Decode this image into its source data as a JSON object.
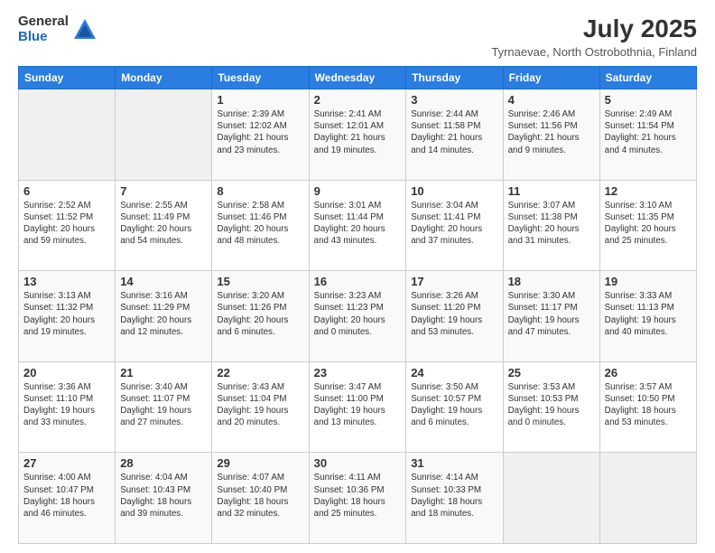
{
  "header": {
    "logo_general": "General",
    "logo_blue": "Blue",
    "title": "July 2025",
    "subtitle": "Tyrnaevae, North Ostrobothnia, Finland"
  },
  "days_of_week": [
    "Sunday",
    "Monday",
    "Tuesday",
    "Wednesday",
    "Thursday",
    "Friday",
    "Saturday"
  ],
  "weeks": [
    [
      {
        "day": "",
        "info": ""
      },
      {
        "day": "",
        "info": ""
      },
      {
        "day": "1",
        "info": "Sunrise: 2:39 AM\nSunset: 12:02 AM\nDaylight: 21 hours and 23 minutes."
      },
      {
        "day": "2",
        "info": "Sunrise: 2:41 AM\nSunset: 12:01 AM\nDaylight: 21 hours and 19 minutes."
      },
      {
        "day": "3",
        "info": "Sunrise: 2:44 AM\nSunset: 11:58 PM\nDaylight: 21 hours and 14 minutes."
      },
      {
        "day": "4",
        "info": "Sunrise: 2:46 AM\nSunset: 11:56 PM\nDaylight: 21 hours and 9 minutes."
      },
      {
        "day": "5",
        "info": "Sunrise: 2:49 AM\nSunset: 11:54 PM\nDaylight: 21 hours and 4 minutes."
      }
    ],
    [
      {
        "day": "6",
        "info": "Sunrise: 2:52 AM\nSunset: 11:52 PM\nDaylight: 20 hours and 59 minutes."
      },
      {
        "day": "7",
        "info": "Sunrise: 2:55 AM\nSunset: 11:49 PM\nDaylight: 20 hours and 54 minutes."
      },
      {
        "day": "8",
        "info": "Sunrise: 2:58 AM\nSunset: 11:46 PM\nDaylight: 20 hours and 48 minutes."
      },
      {
        "day": "9",
        "info": "Sunrise: 3:01 AM\nSunset: 11:44 PM\nDaylight: 20 hours and 43 minutes."
      },
      {
        "day": "10",
        "info": "Sunrise: 3:04 AM\nSunset: 11:41 PM\nDaylight: 20 hours and 37 minutes."
      },
      {
        "day": "11",
        "info": "Sunrise: 3:07 AM\nSunset: 11:38 PM\nDaylight: 20 hours and 31 minutes."
      },
      {
        "day": "12",
        "info": "Sunrise: 3:10 AM\nSunset: 11:35 PM\nDaylight: 20 hours and 25 minutes."
      }
    ],
    [
      {
        "day": "13",
        "info": "Sunrise: 3:13 AM\nSunset: 11:32 PM\nDaylight: 20 hours and 19 minutes."
      },
      {
        "day": "14",
        "info": "Sunrise: 3:16 AM\nSunset: 11:29 PM\nDaylight: 20 hours and 12 minutes."
      },
      {
        "day": "15",
        "info": "Sunrise: 3:20 AM\nSunset: 11:26 PM\nDaylight: 20 hours and 6 minutes."
      },
      {
        "day": "16",
        "info": "Sunrise: 3:23 AM\nSunset: 11:23 PM\nDaylight: 20 hours and 0 minutes."
      },
      {
        "day": "17",
        "info": "Sunrise: 3:26 AM\nSunset: 11:20 PM\nDaylight: 19 hours and 53 minutes."
      },
      {
        "day": "18",
        "info": "Sunrise: 3:30 AM\nSunset: 11:17 PM\nDaylight: 19 hours and 47 minutes."
      },
      {
        "day": "19",
        "info": "Sunrise: 3:33 AM\nSunset: 11:13 PM\nDaylight: 19 hours and 40 minutes."
      }
    ],
    [
      {
        "day": "20",
        "info": "Sunrise: 3:36 AM\nSunset: 11:10 PM\nDaylight: 19 hours and 33 minutes."
      },
      {
        "day": "21",
        "info": "Sunrise: 3:40 AM\nSunset: 11:07 PM\nDaylight: 19 hours and 27 minutes."
      },
      {
        "day": "22",
        "info": "Sunrise: 3:43 AM\nSunset: 11:04 PM\nDaylight: 19 hours and 20 minutes."
      },
      {
        "day": "23",
        "info": "Sunrise: 3:47 AM\nSunset: 11:00 PM\nDaylight: 19 hours and 13 minutes."
      },
      {
        "day": "24",
        "info": "Sunrise: 3:50 AM\nSunset: 10:57 PM\nDaylight: 19 hours and 6 minutes."
      },
      {
        "day": "25",
        "info": "Sunrise: 3:53 AM\nSunset: 10:53 PM\nDaylight: 19 hours and 0 minutes."
      },
      {
        "day": "26",
        "info": "Sunrise: 3:57 AM\nSunset: 10:50 PM\nDaylight: 18 hours and 53 minutes."
      }
    ],
    [
      {
        "day": "27",
        "info": "Sunrise: 4:00 AM\nSunset: 10:47 PM\nDaylight: 18 hours and 46 minutes."
      },
      {
        "day": "28",
        "info": "Sunrise: 4:04 AM\nSunset: 10:43 PM\nDaylight: 18 hours and 39 minutes."
      },
      {
        "day": "29",
        "info": "Sunrise: 4:07 AM\nSunset: 10:40 PM\nDaylight: 18 hours and 32 minutes."
      },
      {
        "day": "30",
        "info": "Sunrise: 4:11 AM\nSunset: 10:36 PM\nDaylight: 18 hours and 25 minutes."
      },
      {
        "day": "31",
        "info": "Sunrise: 4:14 AM\nSunset: 10:33 PM\nDaylight: 18 hours and 18 minutes."
      },
      {
        "day": "",
        "info": ""
      },
      {
        "day": "",
        "info": ""
      }
    ]
  ]
}
